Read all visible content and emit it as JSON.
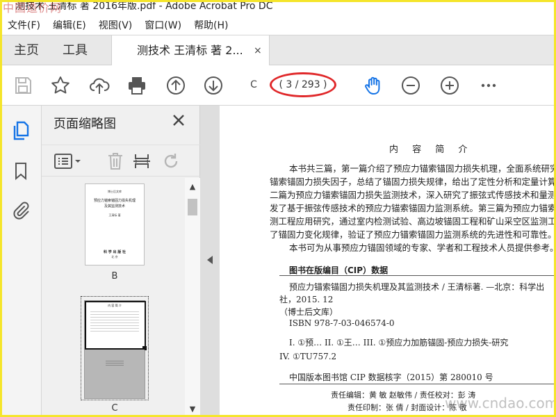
{
  "window": {
    "title": "测技术 王清标 著 2016年版.pdf - Adobe Acrobat Pro DC",
    "watermark": "中国造价网"
  },
  "menu": [
    "文件(F)",
    "编辑(E)",
    "视图(V)",
    "窗口(W)",
    "帮助(H)"
  ],
  "tabs": {
    "home": "主页",
    "tools": "工具",
    "document": "测技术 王清标 著 2...",
    "close_glyph": "×"
  },
  "toolbar": {
    "page_input": "C",
    "page_count": "( 3 / 293 )",
    "accent": "#1473e6",
    "highlight": "#e0282a"
  },
  "icons": {
    "toolbar": [
      "save-icon",
      "star-icon",
      "upload-cloud-icon",
      "print-icon",
      "arrow-up-circle-icon",
      "arrow-down-circle-icon",
      "hand-tool-icon",
      "zoom-out-icon",
      "zoom-in-icon",
      "more-icon"
    ],
    "rail": [
      "page-thumbnails-icon",
      "bookmark-icon",
      "attachment-icon"
    ],
    "panel_tools": [
      "options-list-icon",
      "delete-icon",
      "insert-page-icon",
      "rotate-icon"
    ]
  },
  "panel": {
    "title": "页面缩略图",
    "close_glyph": "✕",
    "thumbs": [
      {
        "label": "B",
        "top_text": "博士后文库",
        "line1": "预应力锚索锚固力损失机理",
        "line2": "及其监测技术",
        "author": "王清标 著",
        "publisher": "科 学 出 版 社",
        "city": "北 京"
      },
      {
        "label": "C",
        "heading": "内 容 简 介"
      }
    ]
  },
  "doc": {
    "heading": "内 容 简 介",
    "paragraph": [
      "本书共三篇，第一篇介绍了预应力锚索锚固力损失机理，全面系统研究了预",
      "锚索锚固力损失因子，总结了锚固力损失规律，给出了定性分析和定量计算方法",
      "二篇为预应力锚索锚固力损失监测技术，深入研究了振弦式传感技术和量测技术",
      "发了基于振弦传感技术的预应力锚索锚固力监测系统。第三篇为预应力锚索锚固",
      "测工程应用研究，通过室内检测试验、高边坡锚固工程和矿山采空区监测工程，",
      "了锚固力变化规律，验证了预应力锚索锚固力监测系统的先进性和可靠性。",
      "本书可为从事预应力锚固领域的专家、学者和工程技术人员提供参考。"
    ],
    "cip_title": "图书在版编目（CIP）数据",
    "cip_lines": [
      "预应力锚索锚固力损失机理及其监测技术 / 王清标著. —北京：科学出",
      "社，2015. 12",
      "（博士后文库）",
      "ISBN  978-7-03-046574-0",
      "I. ①预…    II. ①王…    III. ①预应力加筋锚固-预应力损失-研究",
      "IV. ①TU757.2",
      "中国版本图书馆 CIP 数据核字（2015）第 280010 号"
    ],
    "credits": [
      "责任编辑：黄   敏   赵敏伟  / 责任校对：彭   涛",
      "责任印制：张   倩   / 封面设计：陈   敬"
    ]
  },
  "site_watermark": "www.cndao.com"
}
